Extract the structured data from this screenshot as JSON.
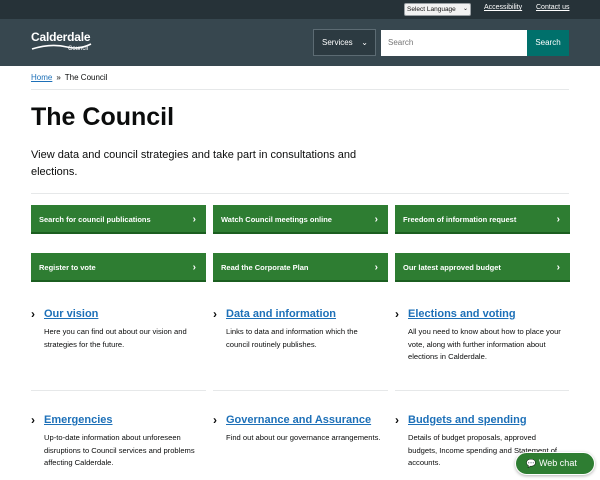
{
  "topbar": {
    "language_select": "Select Language",
    "links": [
      "Accessibility",
      "Contact us"
    ]
  },
  "header": {
    "logo_main": "Calderdale",
    "logo_sub": "Council",
    "services_label": "Services",
    "search_placeholder": "Search",
    "search_button": "Search"
  },
  "breadcrumb": {
    "home": "Home",
    "separator": "»",
    "current": "The Council"
  },
  "page": {
    "title": "The Council",
    "intro": "View data and council strategies and take part in consultations and elections."
  },
  "quick_links": [
    "Search for council publications",
    "Watch Council meetings online",
    "Freedom of information request",
    "Register to vote",
    "Read the Corporate Plan",
    "Our latest approved budget"
  ],
  "cards": [
    {
      "title": "Our vision",
      "desc": "Here you can find out about our vision and strategies for the future."
    },
    {
      "title": "Data and information",
      "desc": "Links to data and information which the council routinely publishes."
    },
    {
      "title": "Elections and voting",
      "desc": "All you need to know about how to place your vote, along with further information about elections in Calderdale."
    },
    {
      "title": "Emergencies",
      "desc": "Up-to-date information about unforeseen disruptions to Council services and problems affecting Calderdale."
    },
    {
      "title": "Governance and Assurance",
      "desc": "Find out about our governance arrangements."
    },
    {
      "title": "Budgets and spending",
      "desc": "Details of budget proposals, approved budgets, Income spending and Statement of accounts."
    }
  ],
  "webchat": {
    "label": "Web chat",
    "icon": "chat-bubble-icon"
  },
  "colors": {
    "topbar": "#263238",
    "header": "#37474f",
    "search_button": "#00706b",
    "quick_link_green": "#2e7d32",
    "link_blue": "#1d70b8"
  }
}
